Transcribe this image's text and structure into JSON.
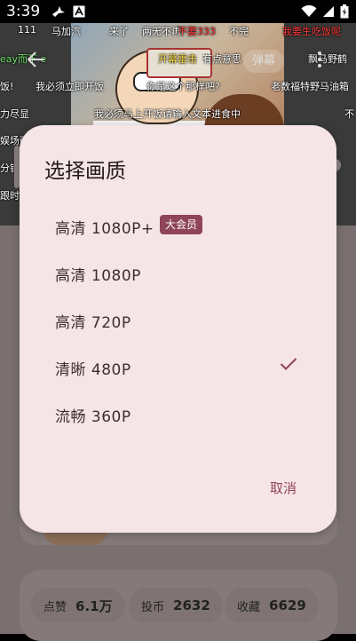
{
  "status_bar": {
    "time": "3:39"
  },
  "video": {
    "danmaku_button_label": "弹幕",
    "danmaku": [
      {
        "text": "111",
        "color": "white"
      },
      {
        "text": "马加汽",
        "color": "white"
      },
      {
        "text": "来了",
        "color": "white"
      },
      {
        "text": "两无不再",
        "color": "white"
      },
      {
        "text": "不要333",
        "color": "red"
      },
      {
        "text": "不完",
        "color": "white"
      },
      {
        "text": "我要生吃饭呢",
        "color": "red"
      },
      {
        "text": "eay而不 e",
        "color": "green"
      },
      {
        "text": "开幕雷击",
        "color": "yellow"
      },
      {
        "text": "有点意思",
        "color": "white"
      },
      {
        "text": "飘马野鹤",
        "color": "white"
      },
      {
        "text": "饭!",
        "color": "white"
      },
      {
        "text": "我必须立即开饭",
        "color": "white"
      },
      {
        "text": "你是这个那样吧?",
        "color": "white"
      },
      {
        "text": "老数福特野马油箱",
        "color": "white"
      },
      {
        "text": "力尽显",
        "color": "white"
      },
      {
        "text": "我必须马上开饭请输入文本进食中",
        "color": "white"
      },
      {
        "text": "不",
        "color": "white"
      },
      {
        "text": "娱场面",
        "color": "white"
      },
      {
        "text": "分钟",
        "color": "white"
      },
      {
        "text": "跟时",
        "color": "white"
      }
    ]
  },
  "page_behind": {
    "stats": [
      {
        "label": "点赞",
        "value": "6.1万"
      },
      {
        "label": "投币",
        "value": "2632"
      },
      {
        "label": "收藏",
        "value": "6629"
      }
    ]
  },
  "dialog": {
    "title": "选择画质",
    "options": [
      {
        "label": "高清 1080P+",
        "badge": "大会员",
        "selected": false
      },
      {
        "label": "高清 1080P",
        "badge": "",
        "selected": false
      },
      {
        "label": "高清 720P",
        "badge": "",
        "selected": false
      },
      {
        "label": "清晰 480P",
        "badge": "",
        "selected": true
      },
      {
        "label": "流畅 360P",
        "badge": "",
        "selected": false
      }
    ],
    "cancel_label": "取消"
  },
  "colors": {
    "dialog_bg": "#f6e5e7",
    "accent": "#8f4458",
    "scrim_page": "#7a7070"
  }
}
